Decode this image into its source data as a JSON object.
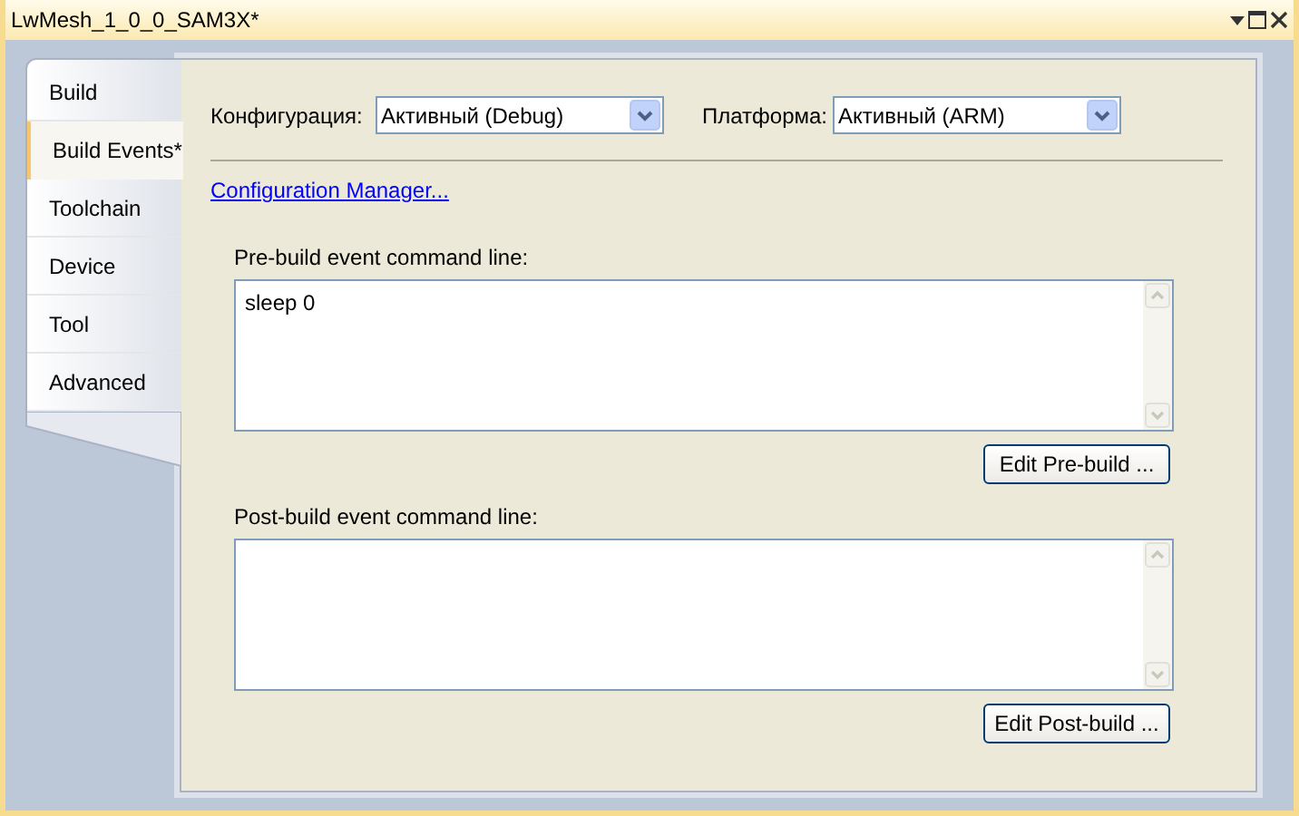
{
  "window": {
    "title": "LwMesh_1_0_0_SAM3X*"
  },
  "tabs": [
    {
      "label": "Build",
      "selected": false
    },
    {
      "label": "Build Events*",
      "selected": true
    },
    {
      "label": "Toolchain",
      "selected": false
    },
    {
      "label": "Device",
      "selected": false
    },
    {
      "label": "Tool",
      "selected": false
    },
    {
      "label": "Advanced",
      "selected": false
    }
  ],
  "configuration": {
    "label": "Конфигурация:",
    "value": "Активный (Debug)"
  },
  "platform": {
    "label": "Платформа:",
    "value": "Активный (ARM)"
  },
  "link": "Configuration Manager...",
  "pre_build": {
    "label": "Pre-build event command line:",
    "value": "sleep 0",
    "button": "Edit Pre-build ..."
  },
  "post_build": {
    "label": "Post-build event command line:",
    "button": "Edit Post-build ..."
  }
}
